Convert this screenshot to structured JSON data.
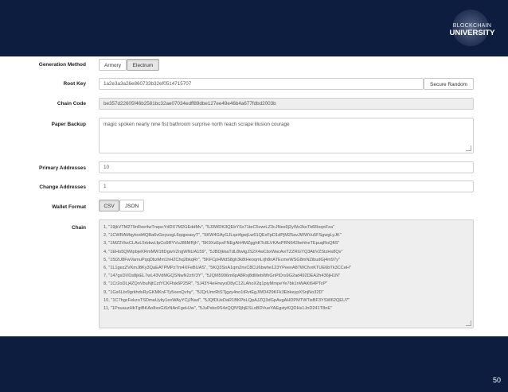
{
  "brand": {
    "line1": "BLOCKCHAIN",
    "line2": "UNIVERSITY"
  },
  "page_number": "50",
  "form": {
    "generation_method": {
      "label": "Generation Method",
      "options": [
        "Armory",
        "Electrum"
      ],
      "selected": "Electrum"
    },
    "root_key": {
      "label": "Root Key",
      "value": "1a2e3a3a26e860733b32ef0514715707",
      "button": "Secure Random"
    },
    "chain_code": {
      "label": "Chain Code",
      "value": "be357d22605f46b2581bc32ae07034edff89dbe127ee49e46b4a677fdbd2003b"
    },
    "paper_backup": {
      "label": "Paper Backup",
      "value": "magic spoken nearly nine fist bathroom surprise north reach scrape illusion courage"
    },
    "primary_addresses": {
      "label": "Primary Addresses",
      "value": "10"
    },
    "change_addresses": {
      "label": "Change Addresses",
      "value": "1"
    },
    "wallet_format": {
      "label": "Wallet Format",
      "options": [
        "CSV",
        "JSON"
      ],
      "selected": "CSV"
    },
    "chain": {
      "label": "Chain",
      "lines": [
        "1, \"19jkVTM2T9nRee4wTnqscYdDX7M2GEddMv\", \"5J3WDK3QEbYSx71teC5vwrLZ3cJNes9j2yWz2koTk6RoqnFza\"",
        "2, \"1CWRAMqykvdi4QBa6vGeyuvgL6qqpeasyT\", \"5KW4GAyGJLqzi4gwjLw61QExFpD1dPjM25avJWWVu5FSgwgLyJK\"",
        "3, \"1MZ2VkxCLAvL5rbkwLfpCo9RYVuJ86MRjh\", \"5K9XzEpxFNEgAH4MZgghKTc8LVKAxPRN642behheTEpuqRoQftS\"",
        "4, \"1EHo5QWtpbjeKRmMW1ftDgwVZngWNUA159\", \"5JBDjkkaTdL8twtgJS2X4wCbxWacAviTZZRGYQ3AbVZStzHs8Qv\"",
        "5, \"15t2U8FwVamuPqqDbzMm1hH2Chq2bkqRr\", \"5KFCpHMdS8gh3k8tHeoqmLrjh8nATEcmeWSG8mNZibudGj4m97y\"",
        "6, \"1L1gezZVKmJ8Ky3QaEATPMPzTm4XFeBUAS\", \"5KQ3SnA1qmZnvC8CU6bwhe123YPeevA87WCfvxKTUE6bTk3CCeH\"",
        "7, \"147gxDVDs8jkEL7wL43VdMGQSNwN2ztV3Y\", \"5JQM5996m6pA8Rxj8dMebWhGnPiDrs9G2ad492DEA2h436jH1N\"",
        "8, \"1Cr2oDLj4ZQnVbuNjtCztYCKFfsk6P25R\", \"5J43Y4eHrwyoD8yC12LAhoX2q1piyMmpeYe7bk1nWAKt64PTcP\"",
        "9, \"1Gs6Lbr9grkhdvRyGKMKnFTy5xenQvhy\", \"5JQrUmrRtSTjgzy4no1tRvtEgJWD429KFk3EbkeypXSnjNo32D\"",
        "10, \"1C7hgcFekzoTSDmaUyky1exWAyYCjJNad\", \"5JQfDUeDaR1BKPbLQpAJZQ3dGpAvgAHDPMTWTisBF3YSW62QEU7\"",
        "11, \"1PxuauzHbTgtBKAo8xoGiSrNAnFgeHJw\", \"5JuPsbo9S4zQQfV9jhjESLoBDVueYAEgxtyKQDHs1JnD241T8nE\""
      ]
    }
  }
}
